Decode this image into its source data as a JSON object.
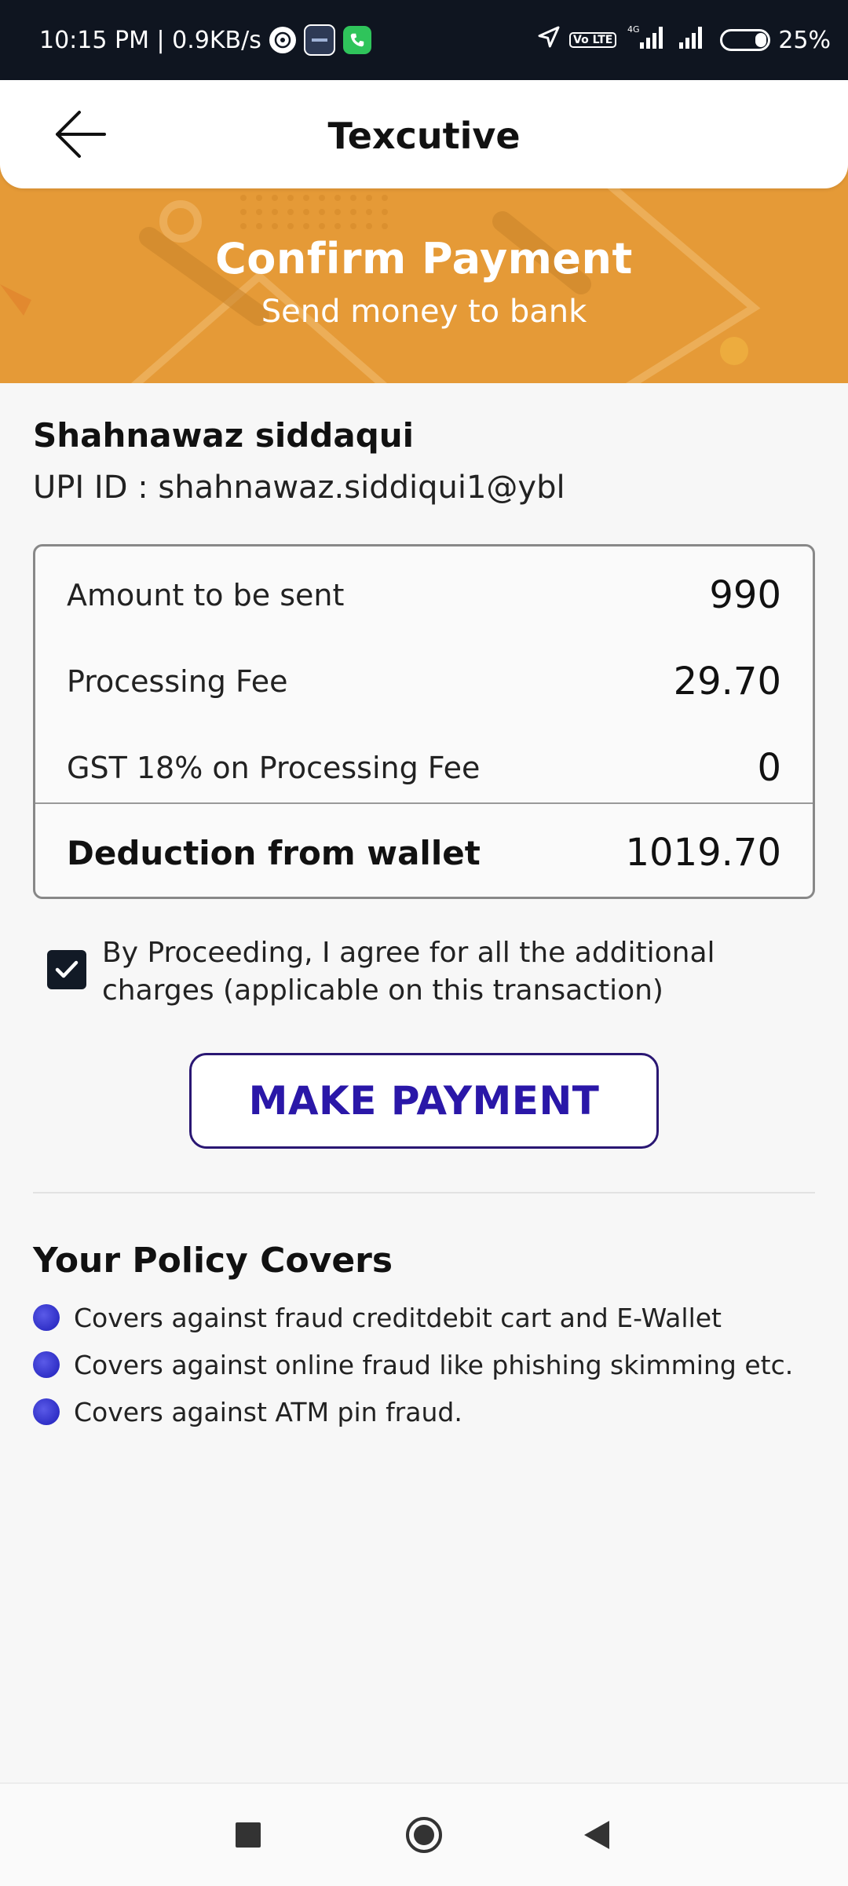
{
  "status_bar": {
    "time_speed": "10:15 PM | 0.9KB/s",
    "volte": "Vo LTE",
    "network": "4G",
    "battery": "25%"
  },
  "app_bar": {
    "title": "Texcutive"
  },
  "hero": {
    "title": "Confirm Payment",
    "subtitle": "Send money to bank"
  },
  "payee": {
    "name": "Shahnawaz siddaqui",
    "upi": "UPI ID : shahnawaz.siddiqui1@ybl"
  },
  "summary": {
    "rows": [
      {
        "label": "Amount to be sent",
        "value": "990"
      },
      {
        "label": "Processing Fee",
        "value": "29.70"
      },
      {
        "label": "GST 18% on Processing Fee",
        "value": "0"
      }
    ],
    "total": {
      "label": "Deduction from wallet",
      "value": "1019.70"
    }
  },
  "agreement": {
    "checked": true,
    "text": "By Proceeding, I agree for all the additional charges (applicable on this transaction)"
  },
  "pay_button": {
    "label": "MAKE PAYMENT"
  },
  "policy": {
    "title": "Your Policy Covers",
    "items": [
      "Covers against fraud creditdebit cart and E-Wallet",
      "Covers against online fraud like phishing skimming etc.",
      "Covers against ATM pin fraud."
    ]
  },
  "colors": {
    "hero_orange": "#e59a37",
    "button_text": "#2a17a8",
    "bullet": "#1d1db8"
  }
}
